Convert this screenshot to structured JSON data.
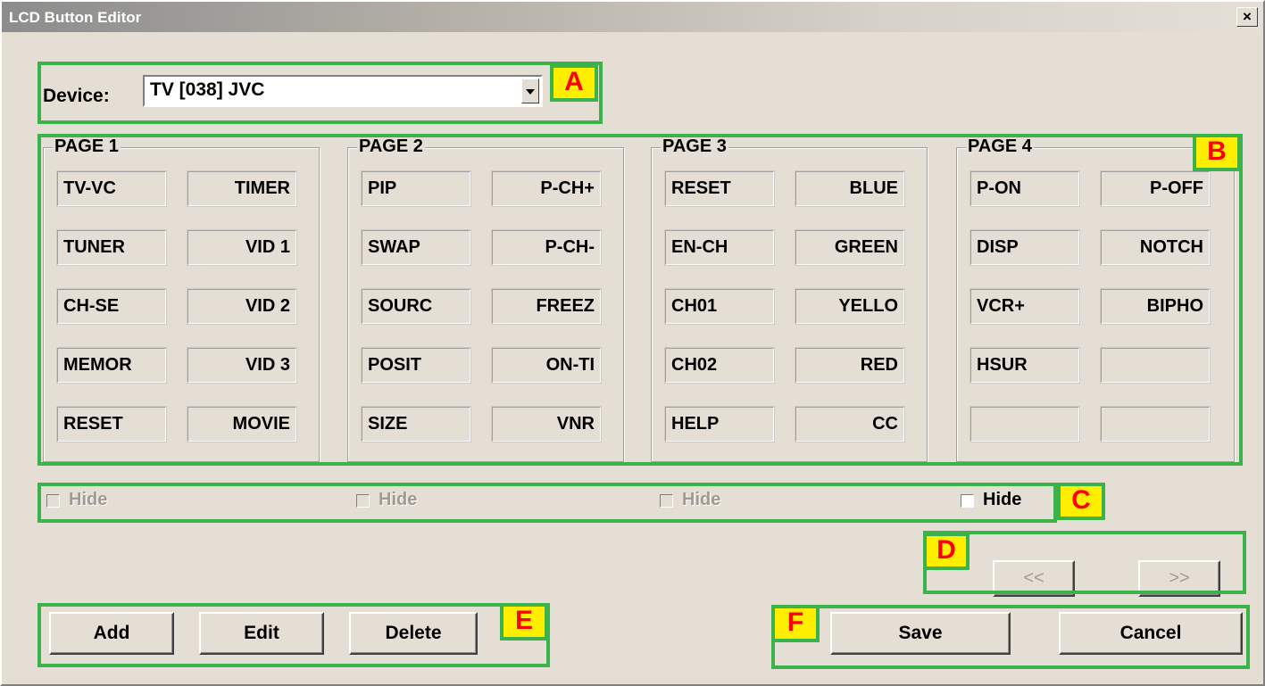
{
  "window": {
    "title": "LCD Button Editor",
    "close_label": "×"
  },
  "device": {
    "label": "Device:",
    "value": "TV [038] JVC"
  },
  "pages": [
    {
      "title": "PAGE 1",
      "buttons": [
        [
          "TV-VC",
          "TIMER"
        ],
        [
          "TUNER",
          "VID 1"
        ],
        [
          "CH-SE",
          "VID 2"
        ],
        [
          "MEMOR",
          "VID 3"
        ],
        [
          "RESET",
          "MOVIE"
        ]
      ]
    },
    {
      "title": "PAGE 2",
      "buttons": [
        [
          "PIP",
          "P-CH+"
        ],
        [
          "SWAP",
          "P-CH-"
        ],
        [
          "SOURC",
          "FREEZ"
        ],
        [
          "POSIT",
          "ON-TI"
        ],
        [
          "SIZE",
          "VNR"
        ]
      ]
    },
    {
      "title": "PAGE 3",
      "buttons": [
        [
          "RESET",
          "BLUE"
        ],
        [
          "EN-CH",
          "GREEN"
        ],
        [
          "CH01",
          "YELLO"
        ],
        [
          "CH02",
          "RED"
        ],
        [
          "HELP",
          "CC"
        ]
      ]
    },
    {
      "title": "PAGE 4",
      "buttons": [
        [
          "P-ON",
          "P-OFF"
        ],
        [
          "DISP",
          "NOTCH"
        ],
        [
          "VCR+",
          "BIPHO"
        ],
        [
          "HSUR",
          ""
        ],
        [
          "",
          ""
        ]
      ]
    }
  ],
  "hide": [
    {
      "label": "Hide",
      "enabled": false
    },
    {
      "label": "Hide",
      "enabled": false
    },
    {
      "label": "Hide",
      "enabled": false
    },
    {
      "label": "Hide",
      "enabled": true
    }
  ],
  "nav": {
    "prev_label": "<<",
    "next_label": ">>"
  },
  "actions": {
    "add_label": "Add",
    "edit_label": "Edit",
    "delete_label": "Delete"
  },
  "dialog": {
    "save_label": "Save",
    "cancel_label": "Cancel"
  },
  "annotations": {
    "a": "A",
    "b": "B",
    "c": "C",
    "d": "D",
    "e": "E",
    "f": "F"
  },
  "colors": {
    "highlight": "#3cb34a",
    "badge_fill": "#ffee00",
    "badge_text": "#ff0000",
    "dialog_bg": "#e4ded5"
  }
}
